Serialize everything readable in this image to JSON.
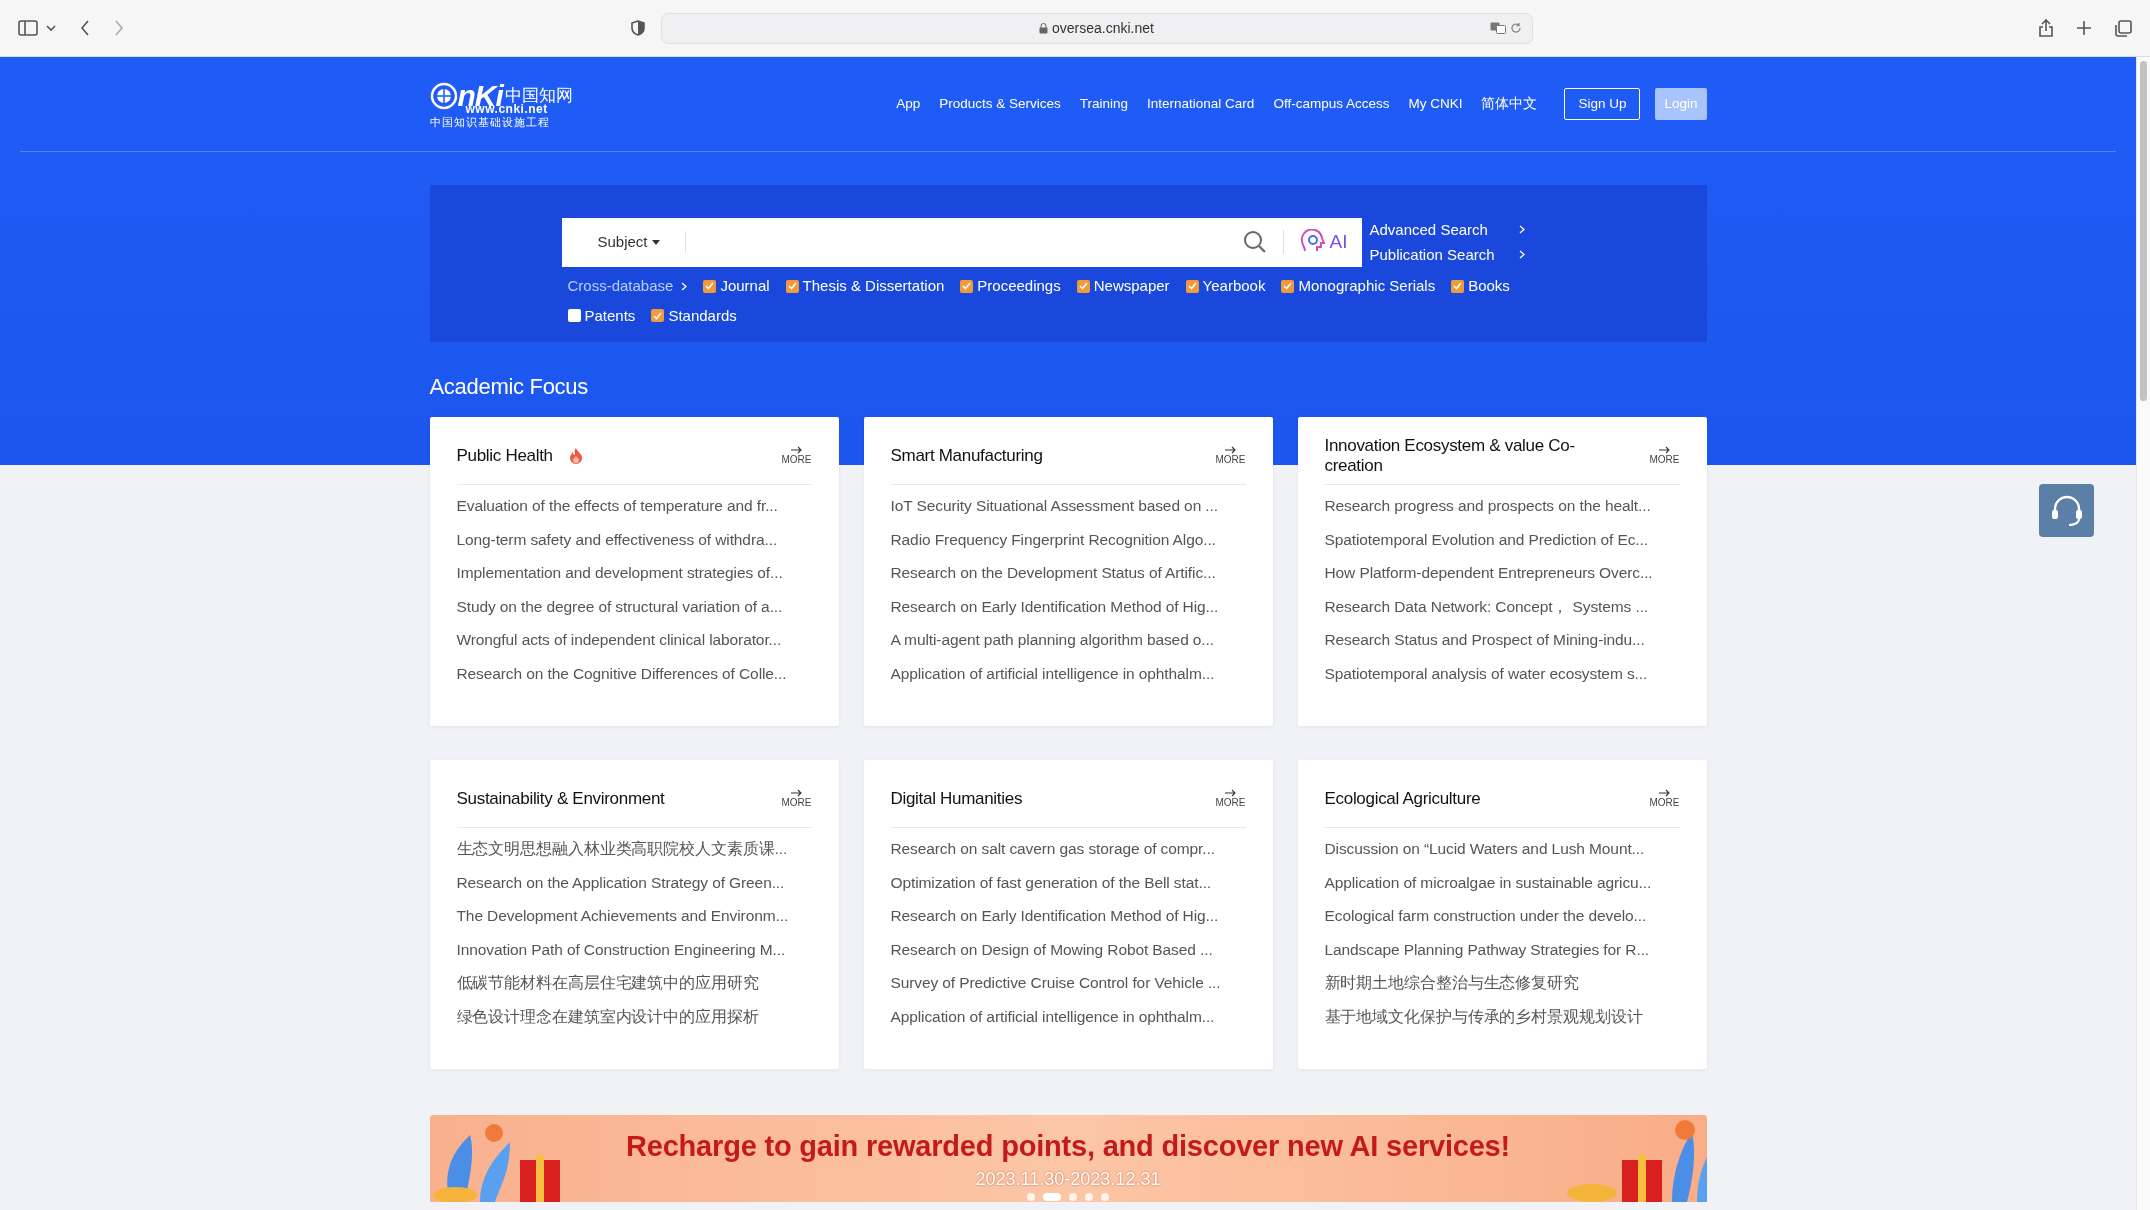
{
  "browser": {
    "url": "oversea.cnki.net"
  },
  "header": {
    "logo": {
      "mark": "nKi",
      "cn_name": "中国知网",
      "domain": "www.cnki.net",
      "tagline": "中国知识基础设施工程"
    },
    "nav": [
      "App",
      "Products & Services",
      "Training",
      "International Card",
      "Off-campus Access",
      "My CNKI",
      "简体中文"
    ],
    "sign_up": "Sign Up",
    "login": "Login"
  },
  "search": {
    "subject": "Subject",
    "ai_label": "AI",
    "links": [
      "Advanced Search",
      "Publication Search"
    ],
    "cross_database": "Cross-database",
    "databases": [
      {
        "label": "Journal",
        "checked": true
      },
      {
        "label": "Thesis & Dissertation",
        "checked": true
      },
      {
        "label": "Proceedings",
        "checked": true
      },
      {
        "label": "Newspaper",
        "checked": true
      },
      {
        "label": "Yearbook",
        "checked": true
      },
      {
        "label": "Monographic Serials",
        "checked": true
      },
      {
        "label": "Books",
        "checked": true
      },
      {
        "label": "Patents",
        "checked": false
      },
      {
        "label": "Standards",
        "checked": true
      }
    ]
  },
  "section_title": "Academic Focus",
  "cards": [
    {
      "title": "Public Health",
      "hot": true,
      "more": "MORE",
      "items": [
        "Evaluation of the effects of temperature and fr...",
        "Long-term safety and effectiveness of withdra...",
        "Implementation and development strategies of...",
        "Study on the degree of structural variation of a...",
        "Wrongful acts of independent clinical laborator...",
        "Research on the Cognitive Differences of Colle..."
      ]
    },
    {
      "title": "Smart Manufacturing",
      "hot": false,
      "more": "MORE",
      "items": [
        "IoT Security Situational Assessment based on ...",
        "Radio Frequency Fingerprint Recognition Algo...",
        "Research on the Development Status of Artific...",
        "Research on Early Identification Method of Hig...",
        "A multi-agent path planning algorithm based o...",
        "Application of artificial intelligence in ophthalm..."
      ]
    },
    {
      "title": "Innovation Ecosystem & value Co-creation",
      "hot": false,
      "more": "MORE",
      "items": [
        "Research progress and prospects on the healt...",
        "Spatiotemporal Evolution and Prediction of Ec...",
        "How Platform-dependent Entrepreneurs Overc...",
        "Research Data Network: Concept， Systems ...",
        "Research Status and Prospect of Mining-indu...",
        "Spatiotemporal analysis of water ecosystem s..."
      ]
    },
    {
      "title": "Sustainability & Environment",
      "hot": false,
      "more": "MORE",
      "items": [
        "生态文明思想融入林业类高职院校人文素质课...",
        "Research on the Application Strategy of Green...",
        "The Development Achievements and Environm...",
        "Innovation Path of Construction Engineering M...",
        "低碳节能材料在高层住宅建筑中的应用研究",
        "绿色设计理念在建筑室内设计中的应用探析"
      ]
    },
    {
      "title": "Digital Humanities",
      "hot": false,
      "more": "MORE",
      "items": [
        "Research on salt cavern gas storage of compr...",
        "Optimization of fast generation of the Bell stat...",
        "Research on Early Identification Method of Hig...",
        "Research on Design of Mowing Robot Based ...",
        "Survey of Predictive Cruise Control for Vehicle ...",
        "Application of artificial intelligence in ophthalm..."
      ]
    },
    {
      "title": "Ecological Agriculture",
      "hot": false,
      "more": "MORE",
      "items": [
        "Discussion on “Lucid Waters and Lush Mount...",
        "Application of microalgae in sustainable agricu...",
        "Ecological farm construction under the develo...",
        "Landscape Planning Pathway Strategies for R...",
        "新时期土地综合整治与生态修复研究",
        "基于地域文化保护与传承的乡村景观规划设计"
      ]
    }
  ],
  "banner": {
    "headline": "Recharge to gain rewarded points, and discover new AI services!",
    "dates": "2023.11.30-2023.12.31",
    "slides": [
      {
        "selected": false
      },
      {
        "selected": true
      },
      {
        "selected": false
      },
      {
        "selected": false
      },
      {
        "selected": false
      }
    ]
  }
}
